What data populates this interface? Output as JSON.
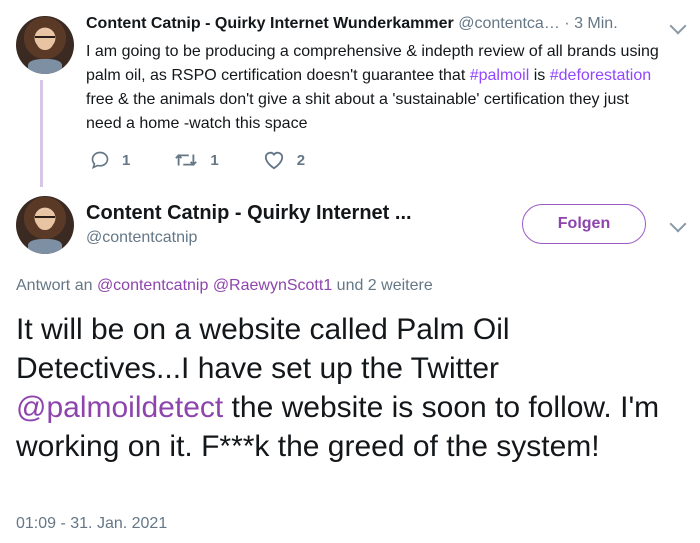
{
  "tweet1": {
    "display_name": "Content Catnip - Quirky Internet Wunderkammer",
    "handle": "@contentca…",
    "separator": "·",
    "time": "3 Min.",
    "text_part1": "I am going to be producing a comprehensive & indepth review of all brands using palm oil, as RSPO certification doesn't guarantee that ",
    "hashtag1": "#palmoil",
    "text_part2": " is ",
    "hashtag2": "#deforestation",
    "text_part3": " free & the animals don't give a shit about a 'sustainable' certification they just need a home -watch this space",
    "reply_count": "1",
    "retweet_count": "1",
    "like_count": "2"
  },
  "tweet2": {
    "display_name": "Content Catnip - Quirky Internet ...",
    "handle": "@contentcatnip",
    "follow_label": "Folgen",
    "reply_prefix": "Antwort an ",
    "reply_mention1": "@contentcatnip",
    "reply_mention2": "@RaewynScott1",
    "reply_suffix": " und 2 weitere",
    "text_part1": "It will be on a website called Palm Oil Detectives...I have set up the Twitter ",
    "mention": "@palmoildetect",
    "text_part2": " the website is soon to follow. I'm working on it. F***k the greed of the system!",
    "timestamp": "01:09 - 31. Jan. 2021"
  },
  "colors": {
    "accent": "#8e44ad",
    "muted": "#657786",
    "thread_line": "#d7c6e6"
  },
  "icons": [
    "reply-icon",
    "retweet-icon",
    "like-icon",
    "chevron-down-icon"
  ]
}
